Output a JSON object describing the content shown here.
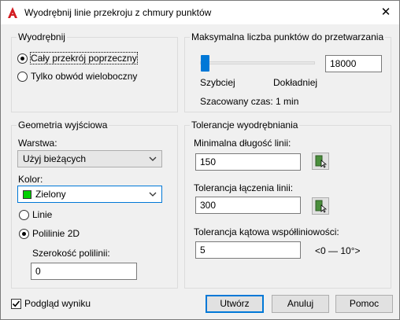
{
  "window": {
    "title": "Wyodrębnij linie przekroju z chmury punktów",
    "close_label": "✕"
  },
  "extract_group": {
    "legend": "Wyodrębnij",
    "options": [
      {
        "label": "Cały przekrój poprzeczny",
        "selected": true
      },
      {
        "label": "Tylko obwód wieloboczny",
        "selected": false
      }
    ]
  },
  "max_points_group": {
    "legend": "Maksymalna liczba punktów do przetwarzania",
    "value": "18000",
    "slider_level": 0.05,
    "left_label": "Szybciej",
    "right_label": "Dokładniej",
    "estimate": "Szacowany czas: 1 min"
  },
  "output_group": {
    "legend": "Geometria wyjściowa",
    "layer_label": "Warstwa:",
    "layer_value": "Użyj bieżących",
    "color_label": "Kolor:",
    "color_value": "Zielony",
    "color_hex": "#00d000",
    "geometry_options": [
      {
        "label": "Linie",
        "selected": false
      },
      {
        "label": "Polilinie 2D",
        "selected": true
      }
    ],
    "polyline_width_label": "Szerokość polilinii:",
    "polyline_width_value": "0"
  },
  "tolerance_group": {
    "legend": "Tolerancje wyodrębniania",
    "min_length_label": "Minimalna długość linii:",
    "min_length_value": "150",
    "join_tol_label": "Tolerancja łączenia linii:",
    "join_tol_value": "300",
    "angle_tol_label": "Tolerancja kątowa współliniowości:",
    "angle_tol_value": "5",
    "angle_range": "<0 — 10°>"
  },
  "footer": {
    "preview_label": "Podgląd wyniku",
    "preview_checked": true,
    "create_label": "Utwórz",
    "cancel_label": "Anuluj",
    "help_label": "Pomoc"
  }
}
